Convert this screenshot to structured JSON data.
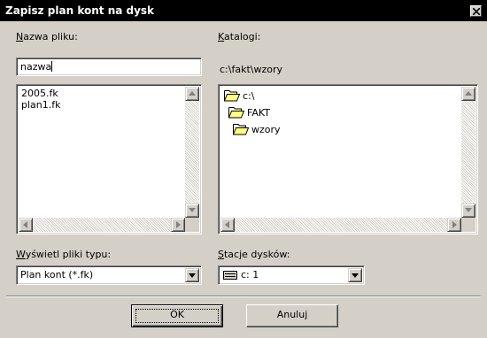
{
  "window": {
    "title": "Zapisz plan kont na dysk"
  },
  "file_name": {
    "label_accel": "N",
    "label_rest": "azwa pliku:",
    "value": "nazwa"
  },
  "files": [
    "2005.fk",
    "plan1.fk"
  ],
  "directories": {
    "label_accel": "K",
    "label_rest": "atalogi:",
    "current_path": "c:\\fakt\\wzory",
    "tree": [
      {
        "name": "c:\\",
        "icon": "open-folder-icon"
      },
      {
        "name": "FAKT",
        "icon": "open-folder-icon"
      },
      {
        "name": "wzory",
        "icon": "open-folder-icon"
      }
    ]
  },
  "file_type": {
    "label_accel": "W",
    "label_rest": "yświetl pliki typu:",
    "value": "Plan kont (*.fk)"
  },
  "drives": {
    "label_accel": "S",
    "label_rest": "tacje dysków:",
    "value": "c: 1",
    "icon": "drive-icon"
  },
  "buttons": {
    "ok": "OK",
    "cancel": "Anuluj"
  }
}
